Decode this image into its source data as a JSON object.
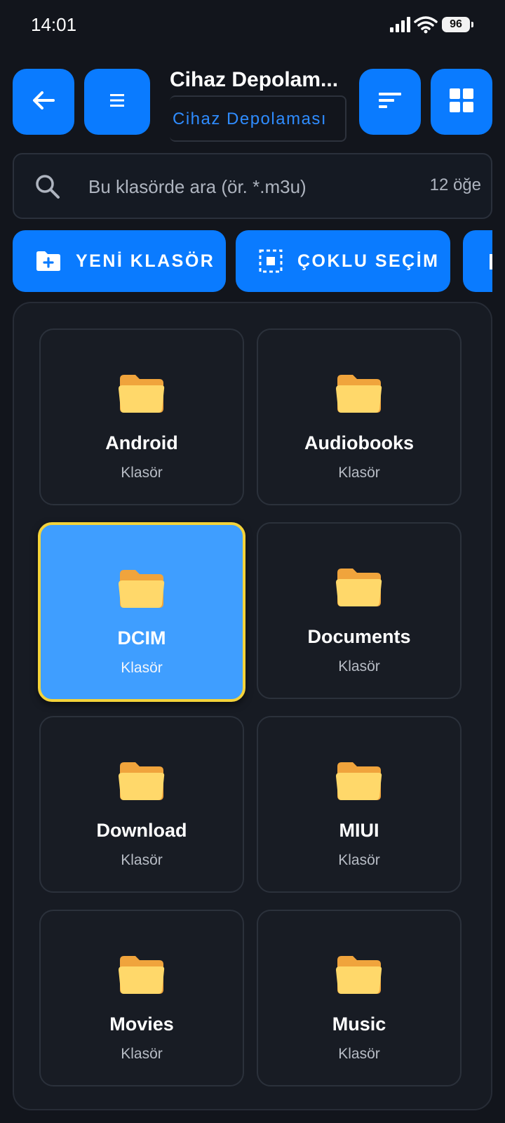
{
  "status": {
    "time": "14:01",
    "battery": "96"
  },
  "header": {
    "title": "Cihaz Depolam...",
    "breadcrumb": "Cihaz Depolaması"
  },
  "search": {
    "placeholder": "Bu klasörde ara (ör. *.m3u)",
    "count": "12 öğe"
  },
  "actions": {
    "new_folder": "YENİ KLASÖR",
    "multi_select": "ÇOKLU SEÇİM"
  },
  "folders": [
    {
      "name": "Android",
      "type": "Klasör"
    },
    {
      "name": "Audiobooks",
      "type": "Klasör"
    },
    {
      "name": "DCIM",
      "type": "Klasör",
      "selected": true
    },
    {
      "name": "Documents",
      "type": "Klasör"
    },
    {
      "name": "Download",
      "type": "Klasör"
    },
    {
      "name": "MIUI",
      "type": "Klasör"
    },
    {
      "name": "Movies",
      "type": "Klasör"
    },
    {
      "name": "Music",
      "type": "Klasör"
    }
  ],
  "colors": {
    "accent": "#0a7bff",
    "selected_bg": "#3f9eff",
    "selected_border": "#f4d33a",
    "background": "#12151c"
  }
}
